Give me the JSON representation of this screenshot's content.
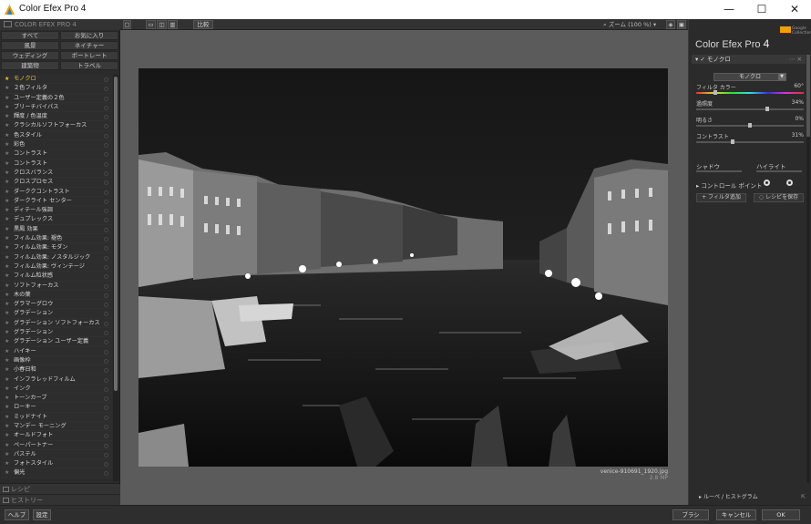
{
  "window": {
    "title": "Color Efex Pro 4",
    "minimize": "—",
    "maximize": "☐",
    "close": "✕"
  },
  "left_panel": {
    "header": "COLOR EFEX PRO 4",
    "categories": [
      "すべて",
      "お気に入り",
      "風景",
      "ネイチャー",
      "ウェディング",
      "ポートレート",
      "建築物",
      "トラベル"
    ],
    "filters": [
      "モノクロ",
      "２色フィルタ",
      "ユーザー定義の２色",
      "ブリーチバイパス",
      "輝度 / 色温度",
      "クラシカルソフトフォーカス",
      "色スタイル",
      "彩色",
      "コントラスト",
      "コントラスト",
      "クロスバランス",
      "クロスプロセス",
      "ダーククコントラスト",
      "ダークライト センター",
      "ディテール強調",
      "デュプレックス",
      "黒鳳 効果",
      "フィルム効果: 褪色",
      "フィルム効果: モダン",
      "フィルム効果: ノスタルジック",
      "フィルム効果: ヴィンテージ",
      "フィルム粒状感",
      "ソフトフォーカス",
      "木の葉",
      "グラマーグロウ",
      "グラデーション",
      "グラデーション ソフトフォーカス",
      "グラデーション",
      "グラデーション ユーザー定義",
      "ハイキー",
      "画像枠",
      "小春日和",
      "インフラレッドフィルム",
      "インク",
      "トーンカーブ",
      "ローキー",
      "ミッドナイト",
      "マンデー モーニング",
      "オールドフォト",
      "ペーパートナー",
      "パステル",
      "フォトスタイル",
      "偏光"
    ],
    "section_recipes": "レシピ",
    "section_history": "ヒストリー"
  },
  "center": {
    "compare_label": "比較",
    "zoom_label": "ズーム (100 %)",
    "filename": "venice-910691_1920.jpg",
    "megapixels": "2.8 MP"
  },
  "right_panel": {
    "brand": "Google Collection",
    "app_name": "Color Efex Pro",
    "app_version": "4",
    "filter_name": "モノクロ",
    "preset": "モノクロ",
    "sliders": [
      {
        "label": "フィルタ カラー",
        "value": "60°",
        "fraction": 0.17,
        "hue": true
      },
      {
        "label": "過照度",
        "value": "34%",
        "fraction": 0.67
      },
      {
        "label": "明るさ",
        "value": "0%",
        "fraction": 0.5
      },
      {
        "label": "コントラスト",
        "value": "31%",
        "fraction": 0.33
      }
    ],
    "shadow_label": "シャドウ",
    "highlight_label": "ハイライト",
    "control_point_label": "コントロール ポイント",
    "add_filter": "フィルタ追加",
    "save_recipe": "レシピを保存",
    "loupe_label": "ルーペ / ヒストグラム"
  },
  "footer": {
    "help": "ヘルプ",
    "settings": "設定",
    "brush": "ブラシ",
    "cancel": "キャンセル",
    "ok": "OK"
  },
  "colors": {
    "accent": "#f2c230",
    "brand": "#f2a000"
  }
}
